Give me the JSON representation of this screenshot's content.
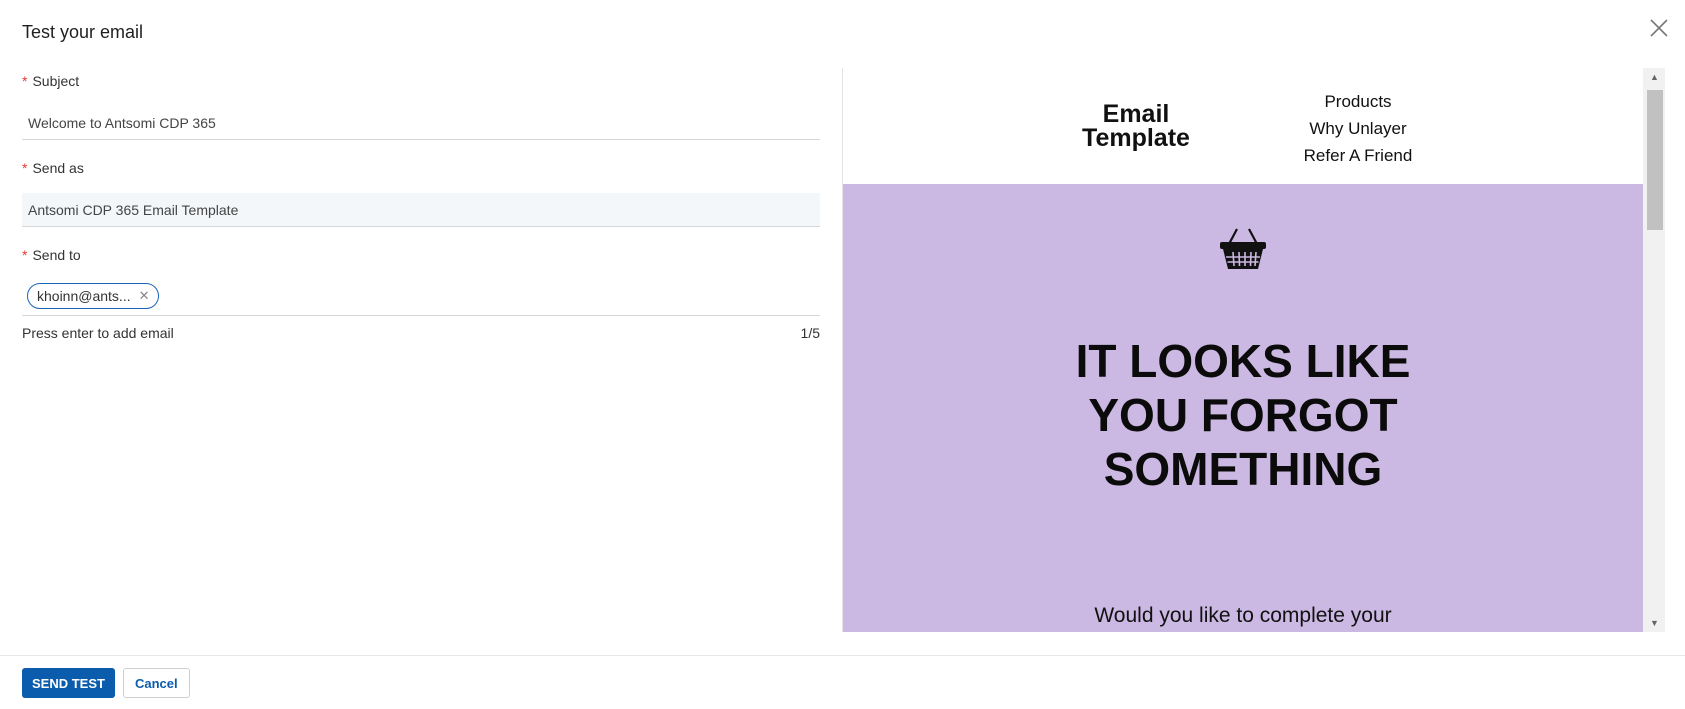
{
  "dialog": {
    "title": "Test your email",
    "close_icon": "close-icon"
  },
  "form": {
    "subject": {
      "label": "Subject",
      "required_mark": "*",
      "value": "Welcome to Antsomi CDP 365"
    },
    "send_as": {
      "label": "Send as",
      "required_mark": "*",
      "value": "Antsomi CDP 365 Email Template"
    },
    "send_to": {
      "label": "Send to",
      "required_mark": "*",
      "chips": [
        {
          "text": "khoinn@ants...",
          "remove_icon": "close-icon"
        }
      ],
      "hint": "Press enter to add email",
      "count": "1/5"
    }
  },
  "preview": {
    "logo": "Email Template",
    "menu": [
      "Products",
      "Why Unlayer",
      "Refer A Friend"
    ],
    "hero_icon": "shopping-basket-icon",
    "headline": "IT LOOKS LIKE YOU FORGOT SOMETHING",
    "subtext": "Would you like to complete your",
    "hero_color": "#cbb8e3"
  },
  "footer": {
    "send_label": "SEND TEST",
    "cancel_label": "Cancel"
  },
  "colors": {
    "accent": "#0b5cad",
    "required": "#e53935"
  }
}
